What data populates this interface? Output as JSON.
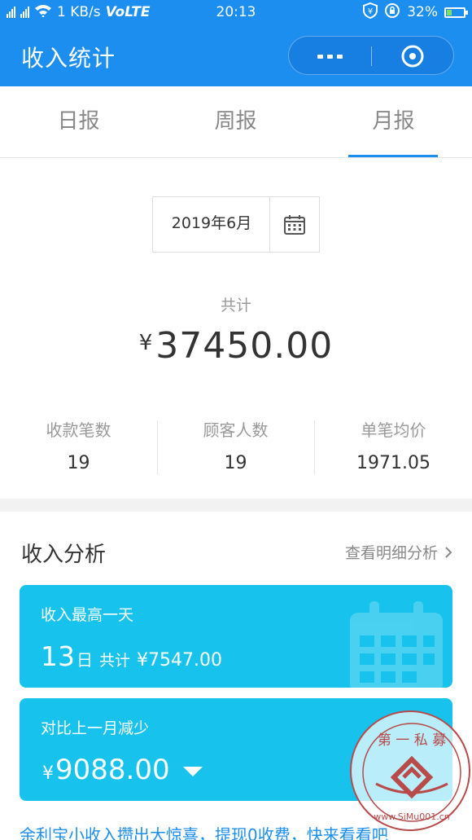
{
  "status_bar": {
    "network": "4G 2G",
    "speed": "1 KB/s",
    "volte": "VoLTE",
    "time": "20:13",
    "battery": "32%",
    "battery_level": 0.32
  },
  "header": {
    "title": "收入统计"
  },
  "tabs": [
    {
      "label": "日报",
      "active": false
    },
    {
      "label": "周报",
      "active": false
    },
    {
      "label": "月报",
      "active": true
    }
  ],
  "summary": {
    "date": "2019年6月",
    "total_label": "共计",
    "currency": "¥",
    "total_amount": "37450.00",
    "stats": [
      {
        "label": "收款笔数",
        "value": "19"
      },
      {
        "label": "顾客人数",
        "value": "19"
      },
      {
        "label": "单笔均价",
        "value": "1971.05"
      }
    ]
  },
  "analysis": {
    "title": "收入分析",
    "detail_link": "查看明细分析",
    "highest_day": {
      "label": "收入最高一天",
      "day": "13",
      "day_unit": "日",
      "sum_label": "共计",
      "sum": "¥7547.00"
    },
    "compare": {
      "label": "对比上一月减少",
      "currency": "¥",
      "amount": "9088.00"
    },
    "promo": "余利宝小收入攒出大惊喜，提现0收费，快来看看吧"
  },
  "watermark": {
    "text": "第一私募",
    "url": "www.SiMu001.cn"
  },
  "colors": {
    "brand_blue": "#1b8ef0",
    "card_cyan": "#17c3ec",
    "watermark_red": "#b84a4a"
  }
}
